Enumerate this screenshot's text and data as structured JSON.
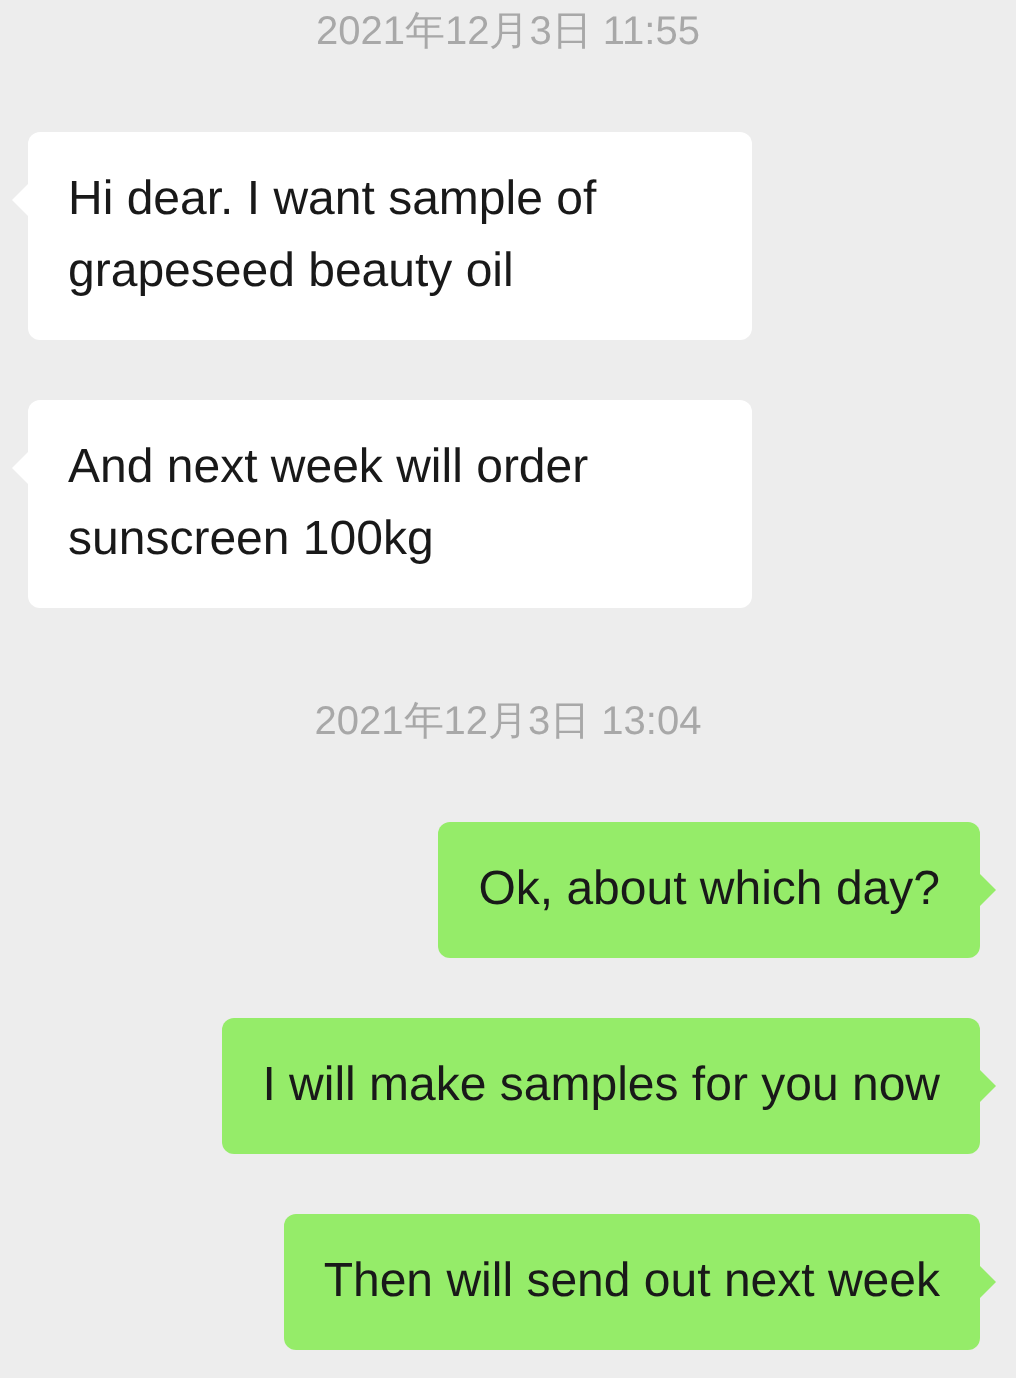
{
  "messages": [
    {
      "kind": "timestamp",
      "text": "2021年12月3日 11:55"
    },
    {
      "kind": "incoming",
      "text": "Hi dear. I want sample of grapeseed beauty oil"
    },
    {
      "kind": "incoming",
      "text": "And next week will order sunscreen 100kg"
    },
    {
      "kind": "timestamp",
      "text": "2021年12月3日 13:04"
    },
    {
      "kind": "outgoing",
      "text": "Ok, about which day?"
    },
    {
      "kind": "outgoing",
      "text": "I will make samples for you now"
    },
    {
      "kind": "outgoing",
      "text": "Then will send out next week"
    }
  ]
}
